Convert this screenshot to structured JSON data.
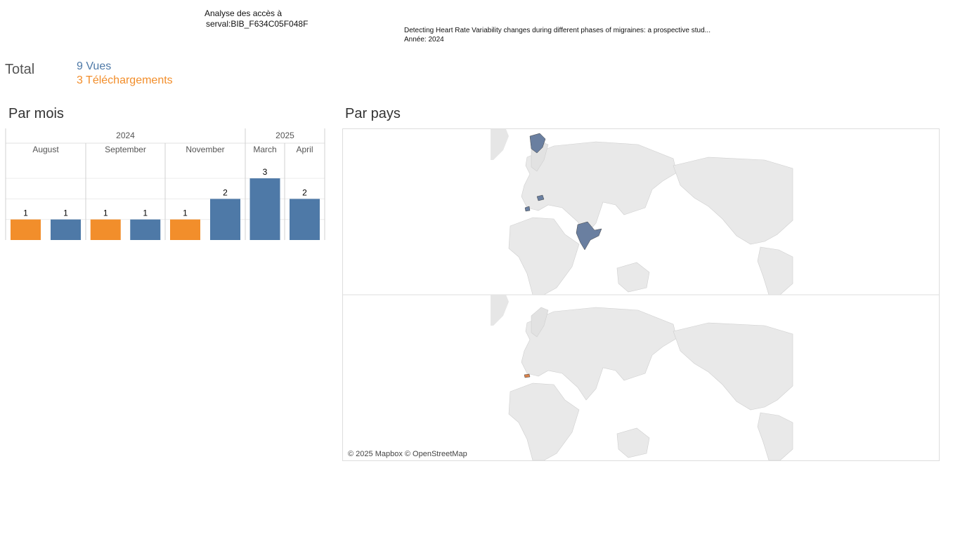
{
  "header": {
    "title_line1": "Analyse des accès à",
    "title_line2": "serval:BIB_F634C05F048F"
  },
  "publication": {
    "title": "Detecting Heart Rate Variability changes during different phases of migraines: a prospective stud...",
    "year_line": "Année: 2024"
  },
  "totals": {
    "label": "Total",
    "views": "9 Vues",
    "downloads": "3 Téléchargements"
  },
  "sections": {
    "by_month": "Par mois",
    "by_country": "Par pays"
  },
  "colors": {
    "views": "#4e79a7",
    "downloads": "#f28e2b"
  },
  "chart_data": {
    "type": "bar",
    "years": [
      {
        "label": "2024",
        "months": [
          "August",
          "September",
          "November"
        ]
      },
      {
        "label": "2025",
        "months": [
          "March",
          "April"
        ]
      }
    ],
    "categories": [
      "August",
      "September",
      "November",
      "March",
      "April"
    ],
    "series": [
      {
        "name": "Téléchargements",
        "values": [
          1,
          1,
          1,
          0,
          0
        ]
      },
      {
        "name": "Vues",
        "values": [
          1,
          1,
          2,
          3,
          2
        ]
      }
    ],
    "ylim": [
      0,
      3
    ],
    "grid": true
  },
  "map": {
    "attribution": "© 2025 Mapbox © OpenStreetMap",
    "panels": [
      {
        "series": "Vues",
        "highlighted": [
          "Norway",
          "Poland",
          "France",
          "India"
        ]
      },
      {
        "series": "Téléchargements",
        "highlighted": [
          "Switzerland"
        ]
      }
    ]
  }
}
